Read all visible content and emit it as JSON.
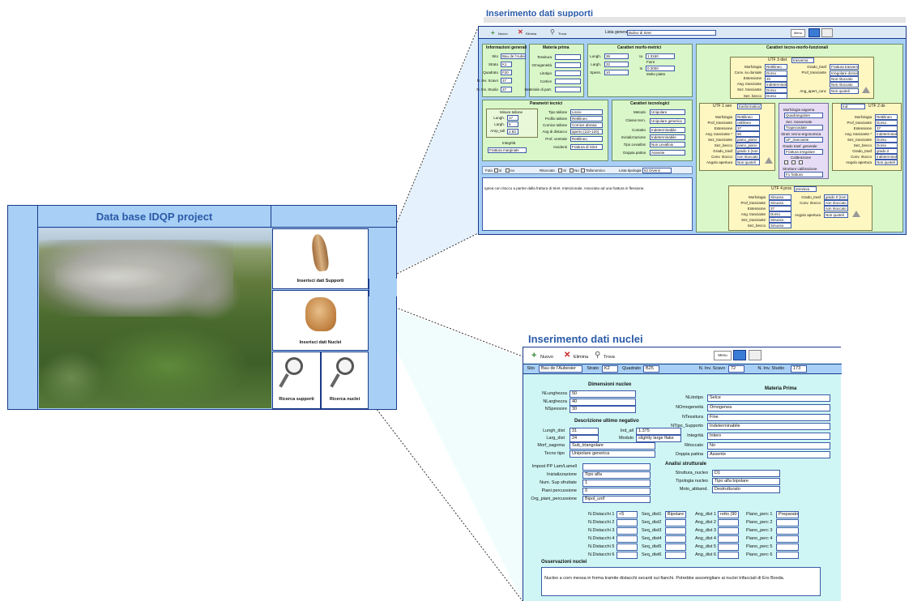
{
  "main": {
    "title": "Data base IDQP project",
    "buttons": {
      "supporti": "Inserisci dati Supporti",
      "nuclei": "Inserisci dati Nuclei",
      "ricerca_supporti": "Ricerca supporti",
      "ricerca_nuclei": "Ricerca nuclei"
    }
  },
  "supporti": {
    "title": "Inserimento dati supporti",
    "toolbar": {
      "nuovo": "Nuovo",
      "elimina": "Elimina",
      "trova": "Trova",
      "lista_label": "Lista generale",
      "lista_value": "Bulino di Siret",
      "menu": "Menu"
    },
    "info": {
      "header": "Informazioni generali",
      "sito_label": "Sito",
      "sito": "Bau de l'Aubesier",
      "strato_label": "Strato",
      "strato": "K1",
      "quadrato_label": "Quadrato",
      "quadrato": "F20",
      "scavo_label": "N. Inv. Scavo",
      "scavo": "37",
      "studio_label": "N. Inv. Studio",
      "studio": "37"
    },
    "materia": {
      "header": "Materia prima",
      "labels": [
        "Tessitura",
        "Omogeneità",
        "Litotipo",
        "Cortice",
        "Materiale di part."
      ]
    },
    "morfo": {
      "header": "Caratteri morfo-metrici",
      "lungh_label": "Lungh.",
      "lungh": "36",
      "largh_label": "Largh.",
      "largh": "32",
      "spess_label": "Spess.",
      "spess": "10",
      "ia_label": "Ia",
      "ia": "1.3160",
      "ia_sub": "Fuire",
      "is_label": "Is",
      "is": "0.3000",
      "is_sub": "Molto piatto"
    },
    "tecno": {
      "header": "Caratteri tecno-morfo-funzionali"
    },
    "utf3": {
      "title": "UTF 3 dist",
      "title_val": "trasversa",
      "labels": [
        "Morfologia",
        "Conv. su dorsale",
        "Estensione",
        "Ang. tranciante",
        "Sez. tranciante",
        "Sez. becco"
      ],
      "vals": [
        "Rettilineo",
        "Dorso",
        "20",
        "Indeterminabile",
        "Dorso",
        "Dorso"
      ],
      "r_labels": [
        "Grado_trasf",
        "Prof_tranciante",
        "",
        "",
        "Ang_apert_conc"
      ],
      "r_vals": [
        "Frattura trasversale",
        "Irregolare dorsale",
        "Non ritoccato",
        "Non ritoccato",
        "Non quoteli"
      ]
    },
    "utf1": {
      "title": "UTF 1 sen",
      "title_val": "trasformativa",
      "labels": [
        "Morfologia",
        "Prof_tranciante",
        "Estensione",
        "Ang. tranciante *",
        "Sez_tranciante",
        "Sez_becco",
        "Grado_trasf",
        "Conv. ritocco",
        "Angolo apertura"
      ],
      "vals": [
        "Rettilineo",
        "rettilineo",
        "37",
        "60",
        "piano_piano",
        "piano_piano",
        "grado 2 (non",
        "non ritoccato",
        "Non quoteli"
      ]
    },
    "mid": {
      "title": "Morfologia sagoma",
      "title_val": "Quadrangolare",
      "sez_label": "Sez. trasversale",
      "sez": "Trapezoidale",
      "strut_label": "Strutt. tecno-ergonomica",
      "strut": "UF_tranciante",
      "grado_label": "Grado trasf. generale",
      "grado": "Frattura irregolare",
      "calib_label": "Calibrazione",
      "strut_calib_label": "Strutture calibrazione",
      "strut_calib": "F1 frattura"
    },
    "utf2": {
      "title": "UTF 2 dx",
      "title_val": "Ind",
      "labels": [
        "Morfologia",
        "Prof_tranciante",
        "Estensione",
        "Ang. tranciante *",
        "Sez_tranciante",
        "Sez_becco",
        "Grado_trasf",
        "Conv. ritocco",
        "Angolo apertura"
      ],
      "vals": [
        "Rettilineo",
        "Dorso",
        "37",
        "Indeterminabile",
        "Dorso",
        "Dorso",
        "grado 2",
        "Indeterminabile",
        "Non quoteli"
      ]
    },
    "utf4": {
      "title": "UTF 4 pros",
      "title_val": "prensiva",
      "labels": [
        "Morfologia",
        "Prof_tranciante",
        "Estensione",
        "Ang. tranciante",
        "Sez_tranciante",
        "Sez_becco"
      ],
      "vals": [
        "Sinuoso",
        "Sinuoso",
        "37",
        "Dorso",
        "Sinuoso",
        "Sinuoso"
      ],
      "r_labels": [
        "Grado_trasf",
        "Conv. ritocco",
        "",
        "Angolo apertura"
      ],
      "r_vals": [
        "grado 0 (non",
        "non ritoccato",
        "non ritoccato",
        "Non quoteli"
      ]
    },
    "param": {
      "header": "Parametri tecnici",
      "misure_label": "Misure tallone",
      "lungh_label": "Lungh.",
      "lungh": "17",
      "largh_label": "Largh.",
      "largh": "6",
      "arnp_label": "Arnp_tall",
      "arnp": "2.83",
      "integrita_label": "Integrità",
      "integrita": "Frattura marginale",
      "r_labels": [
        "Tipo tallone",
        "Profilo tallone",
        "Cornice tallone",
        "Ang di distacco",
        "Prof. ventrale",
        "Incidenti"
      ],
      "r_vals": [
        "Liscio",
        "Rettilineo",
        "Cornice abrasa",
        "aperto (110-120)",
        "Rettilineo",
        "Frattura di Siret"
      ]
    },
    "tecnol": {
      "header": "Caratteri tecnologici",
      "labels": [
        "Metodo",
        "Classe tecn.",
        "Contatto",
        "Inizializzazione",
        "Tipo Levallois",
        "Doppia patina"
      ],
      "vals": [
        "Unipolare",
        "Unipolare generica",
        "Indeterminabile",
        "Indeterminabile",
        "Non Levallois",
        "Assente"
      ]
    },
    "foto": {
      "foto_label": "Foto",
      "si": "si",
      "no": "no",
      "ritoccato_label": "Ritoccato",
      "r_si": "Si",
      "r_no": "No",
      "tallo": "Tallonomico",
      "lista_label": "Lista tipologia",
      "lista_value": "62 Diversi"
    },
    "note": "Ignea con ritocco a partire dalla frattura di Siret. Intenzionale. Associato ad una frattura in flessione."
  },
  "nuclei": {
    "title": "Inserimento dati nuclei",
    "toolbar": {
      "nuovo": "Nuovo",
      "elimina": "Elimina",
      "trova": "Trova",
      "menu": "Menu"
    },
    "top": {
      "sito_label": "Sito",
      "sito": "Bau de l'Aubesier",
      "strato_label": "Strato",
      "strato": "K2",
      "quadrato_label": "Quadrato",
      "quadrato": "B25",
      "scavo_label": "N. Inv. Scavo",
      "scavo": "72",
      "studio_label": "N. Inv. Studio",
      "studio": "173"
    },
    "dim": {
      "header": "Dimensioni nucleo",
      "labels": [
        "NLunghezza",
        "NLarghezza",
        "NSpessore"
      ],
      "vals": [
        "50",
        "40",
        "30"
      ]
    },
    "desc": {
      "header": "Descrizione ultimo negativo",
      "lungh_label": "Lungh_dist",
      "lungh": "31",
      "larg_label": "Larg_dist",
      "larg": "24",
      "ind_label": "Ind_all",
      "ind": "1.375",
      "mod_label": "Modulo",
      "mod": "slightly large flake",
      "morf_label": "Morf_sagoma",
      "morf": "Sub_triangolare",
      "tecno_label": "Tecno tipo",
      "tecno": "Unipolare generica"
    },
    "materia": {
      "header": "Materia Prima",
      "labels": [
        "NLitotipo",
        "NOmogeneità",
        "NTessitura",
        "NTipo_Supporto",
        "Integrità",
        "Ritoccato",
        "Doppia patina"
      ],
      "vals": [
        "Selce",
        "Omogenea",
        "Fine",
        "Indeterminabile",
        "Intero",
        "No",
        "Assente"
      ]
    },
    "impost": {
      "labels": [
        "Impost PP Lam/Lamell",
        "Inizializzazione",
        "Num. Sup sfruttate",
        "Piani percussione",
        "Org_piani_percussione"
      ],
      "vals": [
        "",
        "Tipo alfa",
        "1",
        "0",
        "Bipol_unif"
      ]
    },
    "analisi": {
      "header": "Analisi strutturale",
      "labels": [
        "Struttura_nucleo",
        "Tipologia nucleo",
        "Moto_abband."
      ],
      "vals": [
        "D1",
        "Tipo alfa bipolare",
        "Destrutturato"
      ]
    },
    "dist": {
      "labels": [
        "N.Distacchi 1",
        "N.Distacchi 2",
        "N.Distacchi 3",
        "N.Distacchi 4",
        "N.Distacchi 5",
        "N.Distacchi 6"
      ],
      "vals": [
        "<5",
        "",
        "",
        "",
        "",
        ""
      ],
      "seq_labels": [
        "Seq_dist1",
        "Seq_dist2",
        "Seq_dist3",
        "Seq_dist4",
        "Seq_dist5",
        "Seq_dist6"
      ],
      "seq_vals": [
        "Bipolare",
        "",
        "",
        "",
        "",
        ""
      ],
      "ang_labels": [
        "Ang_dist 1",
        "Ang_dist 2",
        "Ang_dist 3",
        "Ang_dist 4",
        "Ang_dist 5",
        "Ang_dist 6"
      ],
      "ang_vals": [
        "retto (90",
        "",
        "",
        "",
        "",
        ""
      ],
      "piano_labels": [
        "Piano_perc 1",
        "Piano_perc 2",
        "Piano_perc 3",
        "Piano_perc 4",
        "Piano_perc 5",
        "Piano_perc 6"
      ],
      "piano_vals": [
        "Preparato",
        "",
        "",
        "",
        "",
        ""
      ]
    },
    "oss": {
      "header": "Osservazioni nuclei",
      "text": "Nucleo a corn messa in forma tramite distacchi secanti sui fianchi. Potrebbe assomigliare ai nuclei trifacciali di Ero Boxda."
    }
  },
  "colors": {
    "accent": "#9cc5f0",
    "border": "#1a3a8a",
    "nuclei_bg": "#cff6f4",
    "title": "#2a5aa8"
  }
}
